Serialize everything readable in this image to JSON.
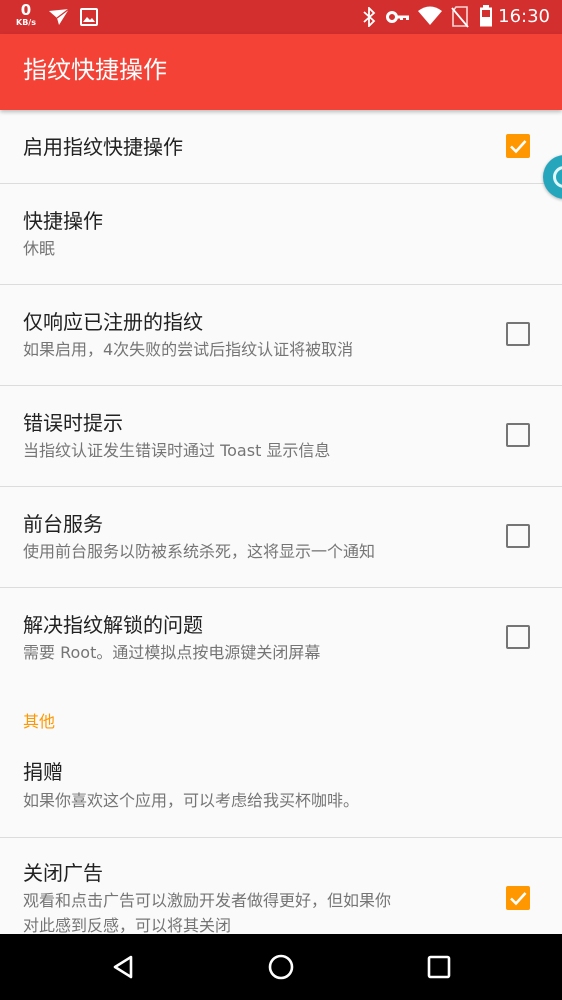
{
  "status_bar": {
    "net_speed_value": "0",
    "net_speed_unit": "KB/s",
    "time": "16:30",
    "icons": [
      "send-icon",
      "image-icon",
      "bluetooth-icon",
      "vpn-key-icon",
      "wifi-icon",
      "no-sim-icon",
      "battery-icon"
    ]
  },
  "app_bar": {
    "title": "指纹快捷操作"
  },
  "preferences": [
    {
      "title": "启用指纹快捷操作",
      "checked": true
    },
    {
      "title": "快捷操作",
      "summary": "休眠"
    },
    {
      "title": "仅响应已注册的指纹",
      "summary": "如果启用，4次失败的尝试后指纹认证将被取消",
      "checked": false
    },
    {
      "title": "错误时提示",
      "summary": "当指纹认证发生错误时通过 Toast 显示信息",
      "checked": false
    },
    {
      "title": "前台服务",
      "summary": "使用前台服务以防被系统杀死，这将显示一个通知",
      "checked": false
    },
    {
      "title": "解决指纹解锁的问题",
      "summary": "需要 Root。通过模拟点按电源键关闭屏幕",
      "checked": false
    }
  ],
  "other_section": {
    "header": "其他",
    "items": [
      {
        "title": "捐赠",
        "summary": "如果你喜欢这个应用，可以考虑给我买杯咖啡。"
      },
      {
        "title": "关闭广告",
        "summary_line1": "观看和点击广告可以激励开发者做得更好，但如果你",
        "summary_line2": "对此感到反感，可以将其关闭",
        "checked": true
      }
    ]
  },
  "nav_bar": {
    "icons": [
      "back-icon",
      "home-icon",
      "recents-icon"
    ]
  },
  "colors": {
    "status_bar": "#d32f2f",
    "app_bar": "#f44336",
    "accent": "#ff9800",
    "floating_button": "#26a6bd"
  }
}
